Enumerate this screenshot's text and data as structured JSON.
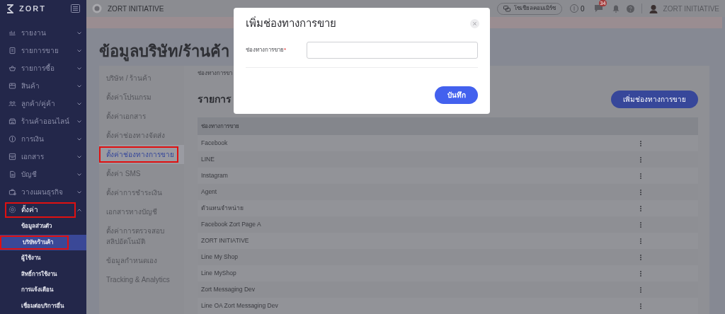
{
  "sidebar": {
    "logo": "ZORT",
    "items": [
      {
        "label": "รายงาน",
        "expanded": false,
        "highlighted": false
      },
      {
        "label": "รายการขาย",
        "expanded": false,
        "highlighted": false
      },
      {
        "label": "รายการซื้อ",
        "expanded": false,
        "highlighted": false
      },
      {
        "label": "สินค้า",
        "expanded": false,
        "highlighted": false
      },
      {
        "label": "ลูกค้า/คู่ค้า",
        "expanded": false,
        "highlighted": false
      },
      {
        "label": "ร้านค้าออนไลน์",
        "expanded": false,
        "highlighted": false
      },
      {
        "label": "การเงิน",
        "expanded": false,
        "highlighted": false
      },
      {
        "label": "เอกสาร",
        "expanded": false,
        "highlighted": false
      },
      {
        "label": "บัญชี",
        "expanded": false,
        "highlighted": false
      },
      {
        "label": "วางแผนธุรกิจ",
        "expanded": false,
        "highlighted": false
      },
      {
        "label": "ตั้งค่า",
        "expanded": true,
        "highlighted": true,
        "children": [
          {
            "label": "ข้อมูลส่วนตัว",
            "selected": false,
            "highlighted": false
          },
          {
            "label": "บริษัท/ร้านค้า",
            "selected": true,
            "highlighted": true
          },
          {
            "label": "ผู้ใช้งาน",
            "selected": false,
            "highlighted": false
          },
          {
            "label": "สิทธิ์การใช้งาน",
            "selected": false,
            "highlighted": false
          },
          {
            "label": "การแจ้งเตือน",
            "selected": false,
            "highlighted": false
          },
          {
            "label": "เชื่อมต่อบริการอื่น",
            "selected": false,
            "highlighted": false
          }
        ]
      }
    ]
  },
  "topbar": {
    "company": "ZORT INITIATIVE",
    "social_button": "โซเชียลคอมเมิร์ซ",
    "credits": "0",
    "chat_badge": "34",
    "user": "ZORT INITIATIVE"
  },
  "page_title": "ข้อมูลบริษัท/ร้านค้า",
  "settings_menu": [
    {
      "label": "บริษัท / ร้านค้า",
      "selected": false,
      "highlighted": false
    },
    {
      "label": "ตั้งค่าโปรแกรม",
      "selected": false,
      "highlighted": false
    },
    {
      "label": "ตั้งค่าเอกสาร",
      "selected": false,
      "highlighted": false
    },
    {
      "label": "ตั้งค่าช่องทางจัดส่ง",
      "selected": false,
      "highlighted": false
    },
    {
      "label": "ตั้งค่าช่องทางการขาย",
      "selected": true,
      "highlighted": true
    },
    {
      "label": "ตั้งค่า SMS",
      "selected": false,
      "highlighted": false
    },
    {
      "label": "ตั้งค่าการชำระเงิน",
      "selected": false,
      "highlighted": false
    },
    {
      "label": "เอกสารทางบัญชี",
      "selected": false,
      "highlighted": false
    },
    {
      "label": "ตั้งค่าการตรวจสอบสลิปอัตโนมัติ",
      "selected": false,
      "highlighted": false
    },
    {
      "label": "ข้อมูลกำหนดเอง",
      "selected": false,
      "highlighted": false
    },
    {
      "label": "Tracking & Analytics",
      "selected": false,
      "highlighted": false
    }
  ],
  "breadcrumb": "ช่องทางการขา",
  "list_title": "รายการ",
  "add_button": "เพิ่มช่องทางการขาย",
  "table": {
    "columns": [
      "ช่องทางการขาย"
    ],
    "rows": [
      "Facebook",
      "LINE",
      "Instagram",
      "Agent",
      "ตัวแทนจำหน่าย",
      "Facebook Zort Page A",
      "ZORT INITIATIVE",
      "Line My Shop",
      "Line MyShop",
      "Zort Messaging Dev",
      "Line OA Zort Messaging Dev"
    ]
  },
  "modal": {
    "title": "เพิ่มช่องทางการขาย",
    "field_label": "ช่องทางการขาย",
    "required": true,
    "required_mark": "*",
    "save_button": "บันทึก"
  }
}
